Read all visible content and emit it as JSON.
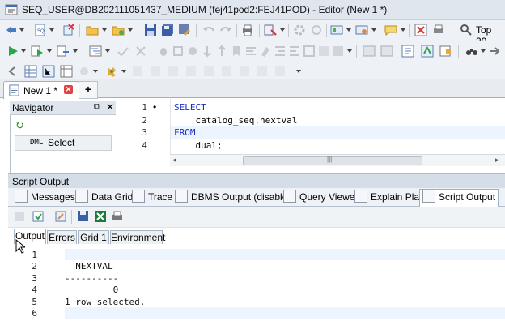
{
  "window": {
    "title": "SEQ_USER@DB202111051437_MEDIUM (fej41pod2:FEJ41POD) - Editor (New 1 *)"
  },
  "toolbar": {
    "top20_label": "Top 20"
  },
  "editor_tab": {
    "label": "New 1 *",
    "close_glyph": "✕",
    "add_glyph": "+"
  },
  "navigator": {
    "title": "Navigator",
    "pin_glyph": "⧉",
    "close_glyph": "✕",
    "refresh_glyph": "↻",
    "dml_kind": "DML",
    "dml_label": "Select"
  },
  "editor": {
    "line_numbers": [
      "1",
      "2",
      "3",
      "4"
    ],
    "current_line_marker": "•",
    "lines": [
      {
        "keyword": "SELECT",
        "text": ""
      },
      {
        "keyword": "",
        "text": "    catalog_seq.nextval"
      },
      {
        "keyword": "FROM",
        "text": ""
      },
      {
        "keyword": "",
        "text": "    dual;"
      }
    ],
    "scroll_grip": "|||",
    "scroll_left": "◂",
    "scroll_right": "▸"
  },
  "script_output": {
    "title": "Script Output",
    "tabs": [
      "Messages",
      "Data Grid",
      "Trace",
      "DBMS Output (disabled)",
      "Query Viewer",
      "Explain Plan",
      "Script Output"
    ],
    "subtabs": [
      "Output",
      "Errors",
      "Grid 1",
      "Environment"
    ],
    "line_numbers": [
      "1",
      "2",
      "3",
      "4",
      "5",
      "6"
    ],
    "lines": [
      "",
      "  NEXTVAL",
      "----------",
      "         0",
      "1 row selected.",
      ""
    ]
  },
  "colors": {
    "keyword": "#1a2fc4",
    "highlight": "#ecf4fd",
    "titlebar": "#dfe6ee"
  }
}
